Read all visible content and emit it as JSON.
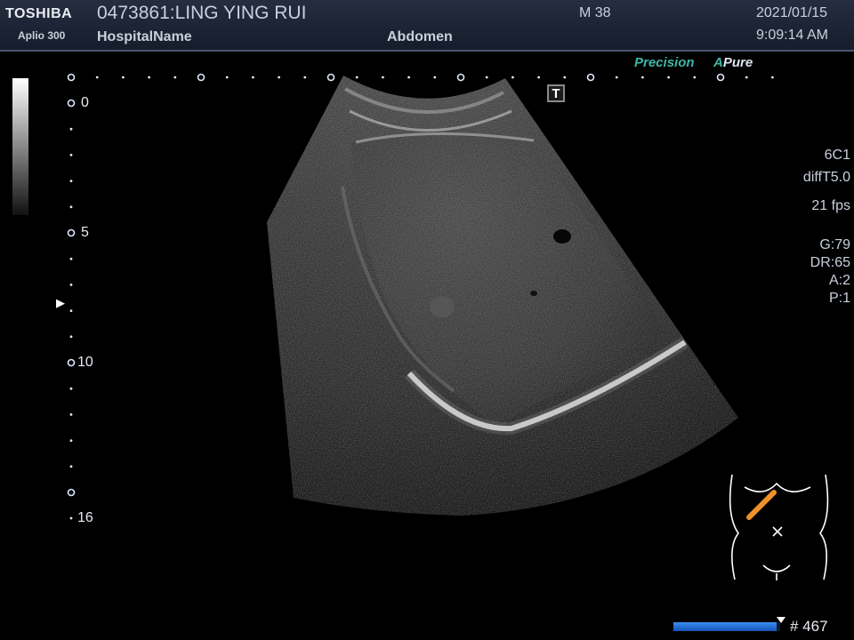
{
  "header": {
    "brand": "TOSHIBA",
    "model": "Aplio 300",
    "patient": "0473861:LING YING RUI",
    "hospital": "HospitalName",
    "preset": "Abdomen",
    "age_sex": "M 38",
    "date": "2021/01/15",
    "time": "9:09:14 AM"
  },
  "modes": {
    "precision": "Precision",
    "apure_a": "A",
    "apure_rest": "Pure"
  },
  "probe": {
    "name": "6C1",
    "mode": "diffT5.0",
    "fps": "21 fps"
  },
  "settings": {
    "gain": "G:79",
    "dynamic_range": "DR:65",
    "a": "A:2",
    "p": "P:1"
  },
  "depth_scale": {
    "labels": [
      "0",
      "5",
      "10",
      "16"
    ],
    "unit_max": 16
  },
  "tgc_marker": "T",
  "cine": {
    "frame_label": "# 467",
    "progress_fraction": 0.97
  },
  "colors": {
    "accent_teal": "#3fb5a8",
    "bodymark_probe": "#f0902a",
    "scale_dot": "#dfe8ff"
  }
}
